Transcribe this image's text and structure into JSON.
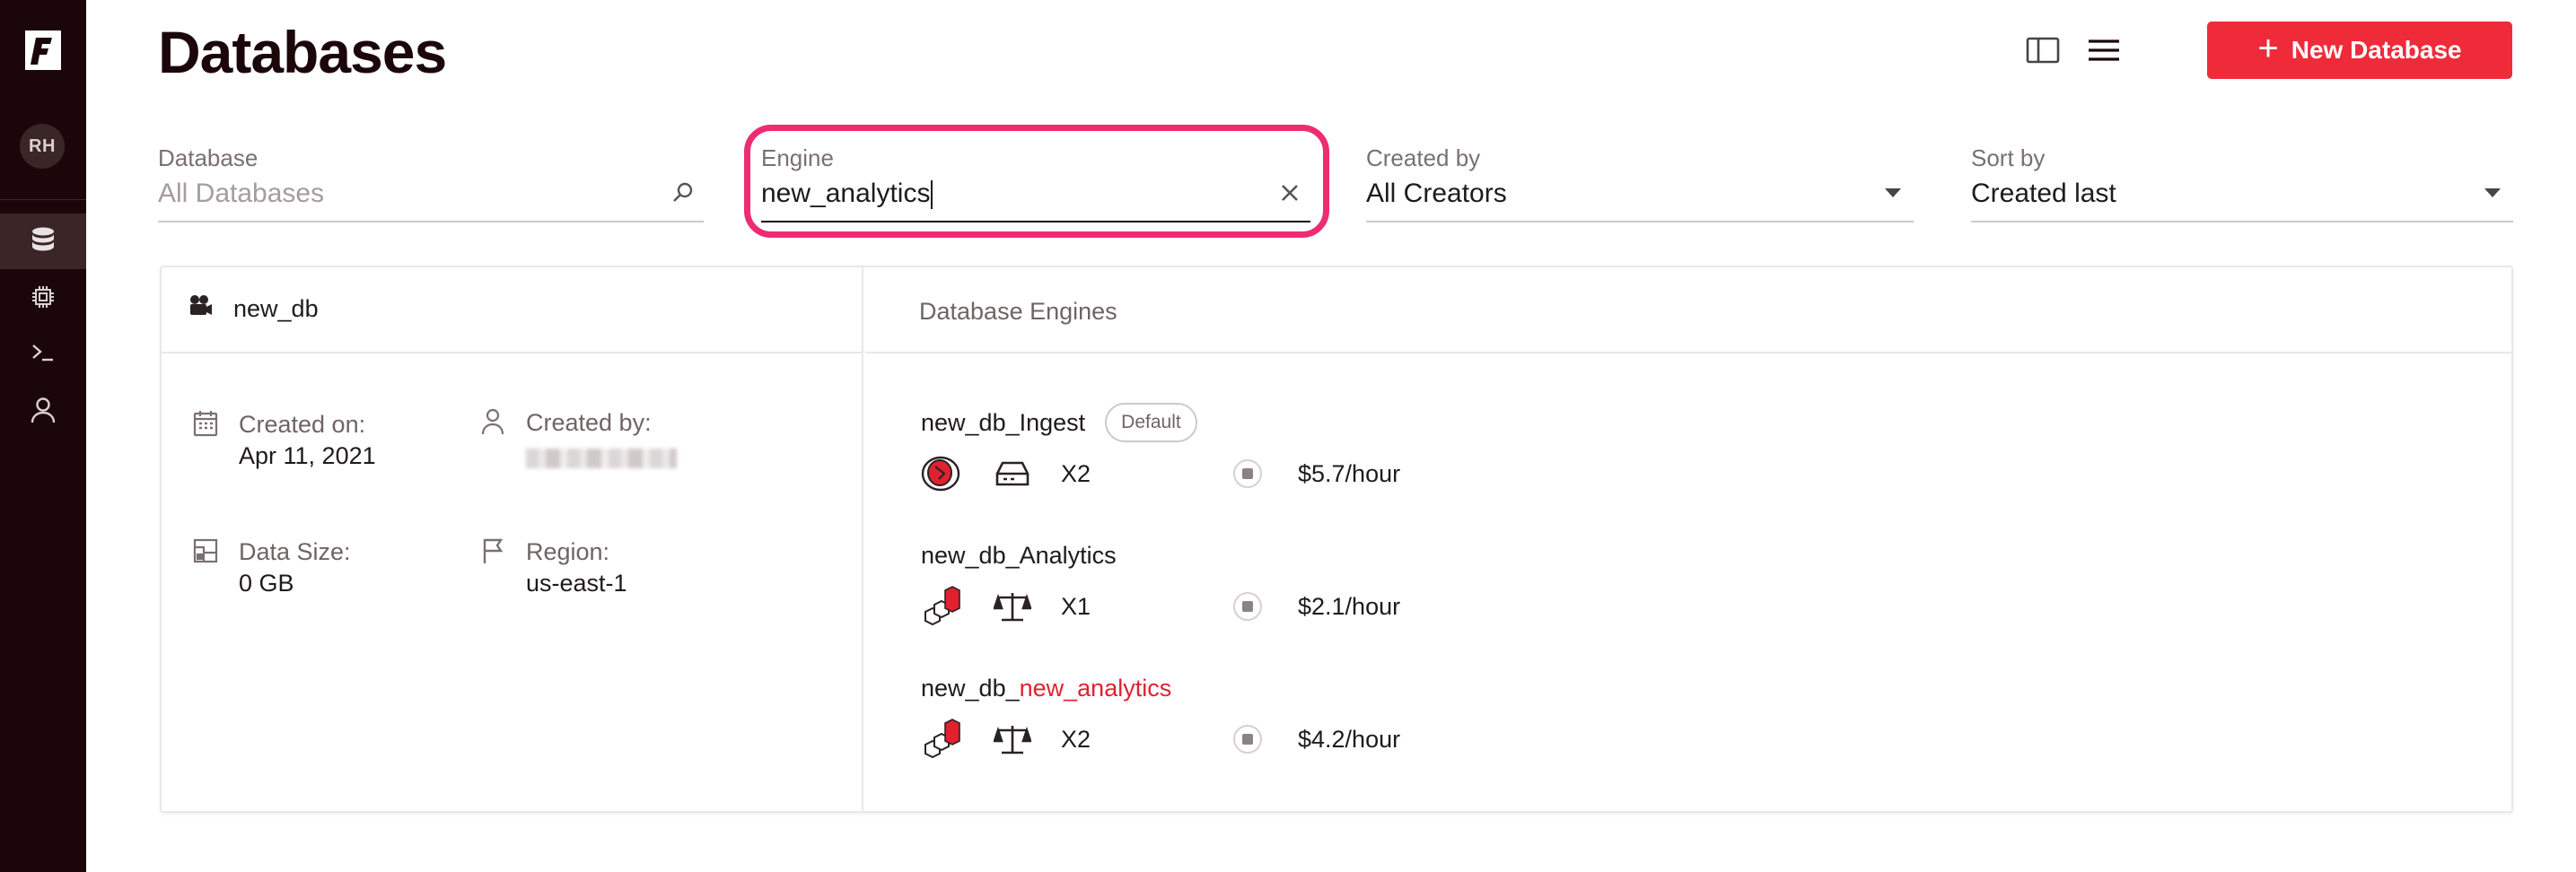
{
  "sidebar": {
    "logo_letter": "F",
    "avatar_initials": "RH",
    "items": [
      {
        "icon": "database-icon",
        "active": true
      },
      {
        "icon": "chip-icon",
        "active": false
      },
      {
        "icon": "terminal-icon",
        "active": false
      },
      {
        "icon": "user-icon",
        "active": false
      }
    ]
  },
  "header": {
    "title": "Databases",
    "new_button_label": "New Database",
    "new_button_color": "#ef2b3a"
  },
  "filters": {
    "database": {
      "label": "Database",
      "placeholder": "All Databases"
    },
    "engine": {
      "label": "Engine",
      "value": "new_analytics"
    },
    "created_by": {
      "label": "Created by",
      "value": "All Creators"
    },
    "sort_by": {
      "label": "Sort by",
      "value": "Created last"
    }
  },
  "highlight_color": "#ee2c72",
  "database": {
    "name": "new_db",
    "created_on_label": "Created on:",
    "created_on": "Apr 11, 2021",
    "created_by_label": "Created by:",
    "data_size_label": "Data Size:",
    "data_size": "0 GB",
    "region_label": "Region:",
    "region": "us-east-1"
  },
  "engines_panel": {
    "title": "Database Engines",
    "engines": [
      {
        "name": "new_db_Ingest",
        "badge": "Default",
        "count": "X2",
        "price": "$5.7/hour"
      },
      {
        "name": "new_db_Analytics",
        "count": "X1",
        "price": "$2.1/hour"
      },
      {
        "name_prefix": "new_db_",
        "name_match": "new_analytics",
        "count": "X2",
        "price": "$4.2/hour"
      }
    ]
  }
}
